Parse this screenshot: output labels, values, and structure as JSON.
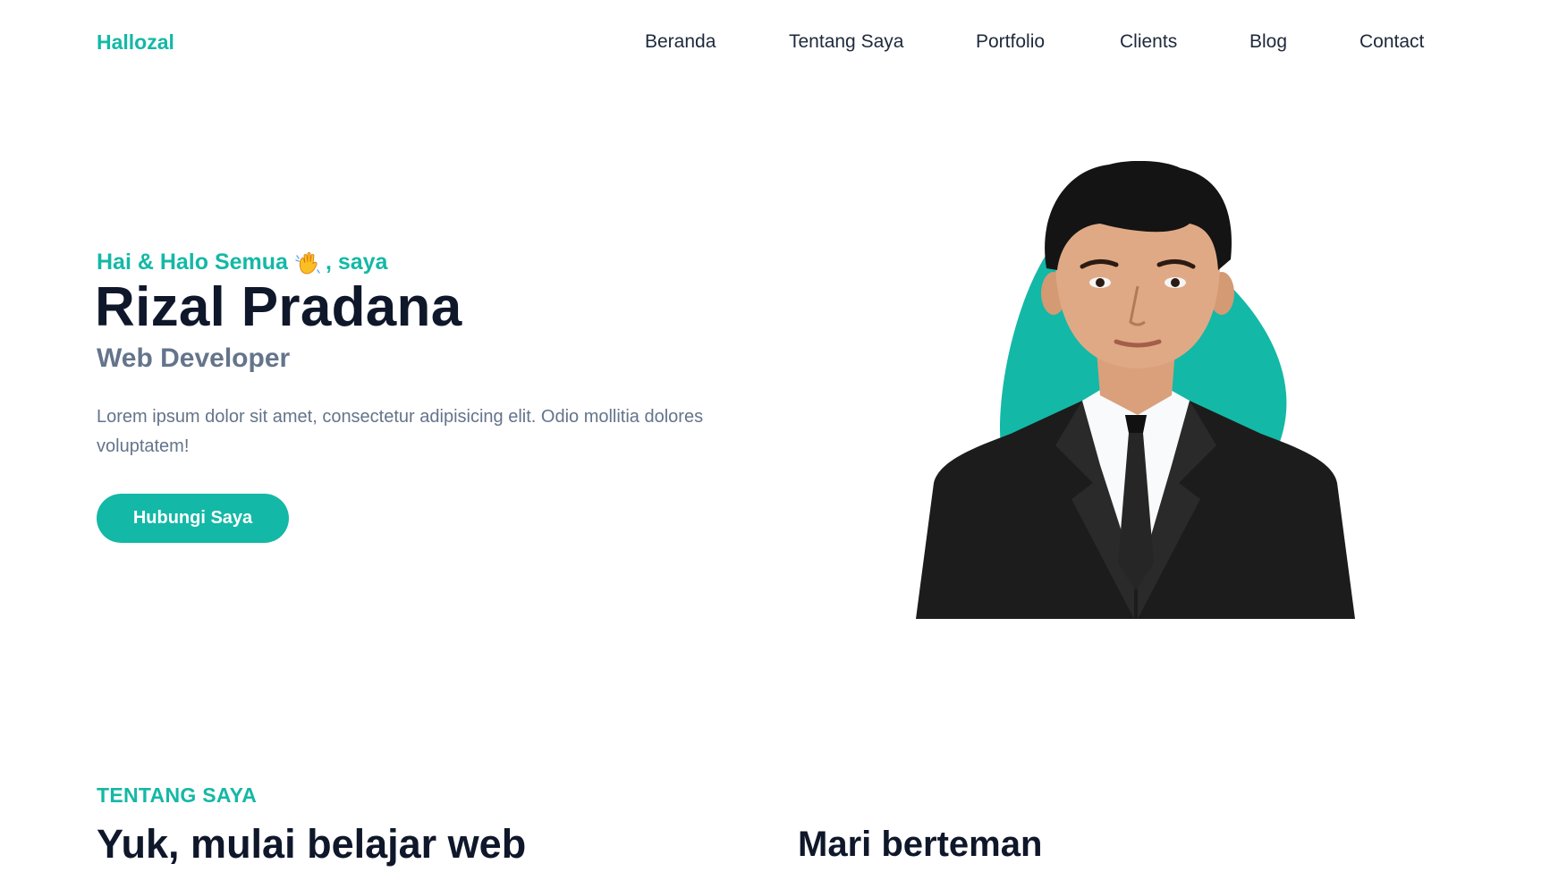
{
  "brand": {
    "name": "Hallozal",
    "color": "#14b8a6"
  },
  "nav": {
    "items": [
      {
        "label": "Beranda"
      },
      {
        "label": "Tentang Saya"
      },
      {
        "label": "Portfolio"
      },
      {
        "label": "Clients"
      },
      {
        "label": "Blog"
      },
      {
        "label": "Contact"
      }
    ]
  },
  "hero": {
    "greeting_before": "Hai & Halo Semua",
    "greeting_icon": "waving-hand-icon",
    "greeting_after": ", saya",
    "name": "Rizal Pradana",
    "role": "Web Developer",
    "description": "Lorem ipsum dolor sit amet, consectetur adipisicing elit. Odio mollitia dolores voluptatem!",
    "cta_label": "Hubungi Saya",
    "accent_color": "#14b8a6"
  },
  "about": {
    "eyebrow": "TENTANG SAYA",
    "title": "Yuk, mulai belajar web",
    "right_title": "Mari berteman"
  }
}
